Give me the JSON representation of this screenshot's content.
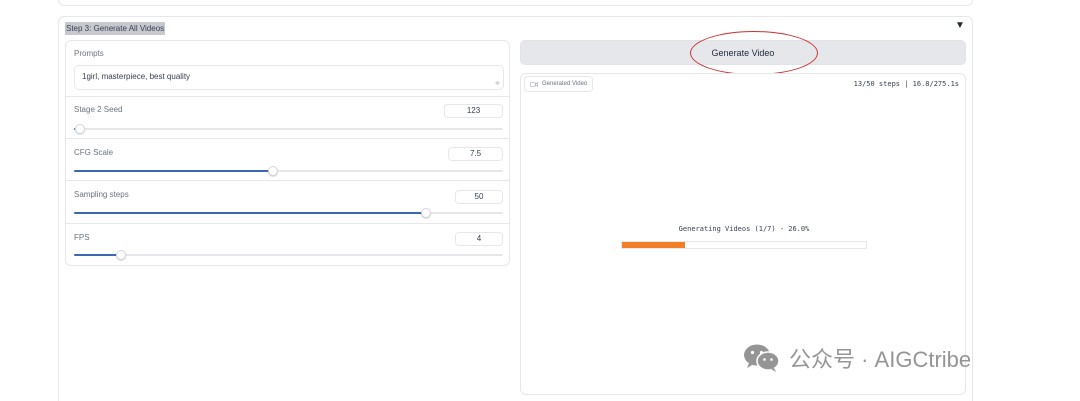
{
  "section": {
    "title": "Step 3: Generate All Videos",
    "toggle_glyph": "▼"
  },
  "prompt": {
    "label": "Prompts",
    "value": "1girl, masterpiece, best quality"
  },
  "sliders": [
    {
      "label": "Stage 2 Seed",
      "value": "123",
      "fraction": 0.015
    },
    {
      "label": "CFG Scale",
      "value": "7.5",
      "fraction": 0.465
    },
    {
      "label": "Sampling steps",
      "value": "50",
      "fraction": 0.82
    },
    {
      "label": "FPS",
      "value": "4",
      "fraction": 0.11
    }
  ],
  "generate": {
    "label": "Generate Video"
  },
  "output": {
    "tag_label": "Generated Video",
    "tag_icon": "video-camera-icon",
    "timer": "13/50 steps | 16.8/275.1s",
    "status": "Generating Videos (1/7) - 26.0%",
    "progress_fraction": 0.26
  },
  "watermark": {
    "text": "公众号 · AIGCtribe",
    "icon": "wechat-icon"
  },
  "colors": {
    "slider_fill": "#3b68b5",
    "progress_fill": "#f07f28",
    "annotation": "#c8342f",
    "button_bg": "#e5e7eb"
  }
}
